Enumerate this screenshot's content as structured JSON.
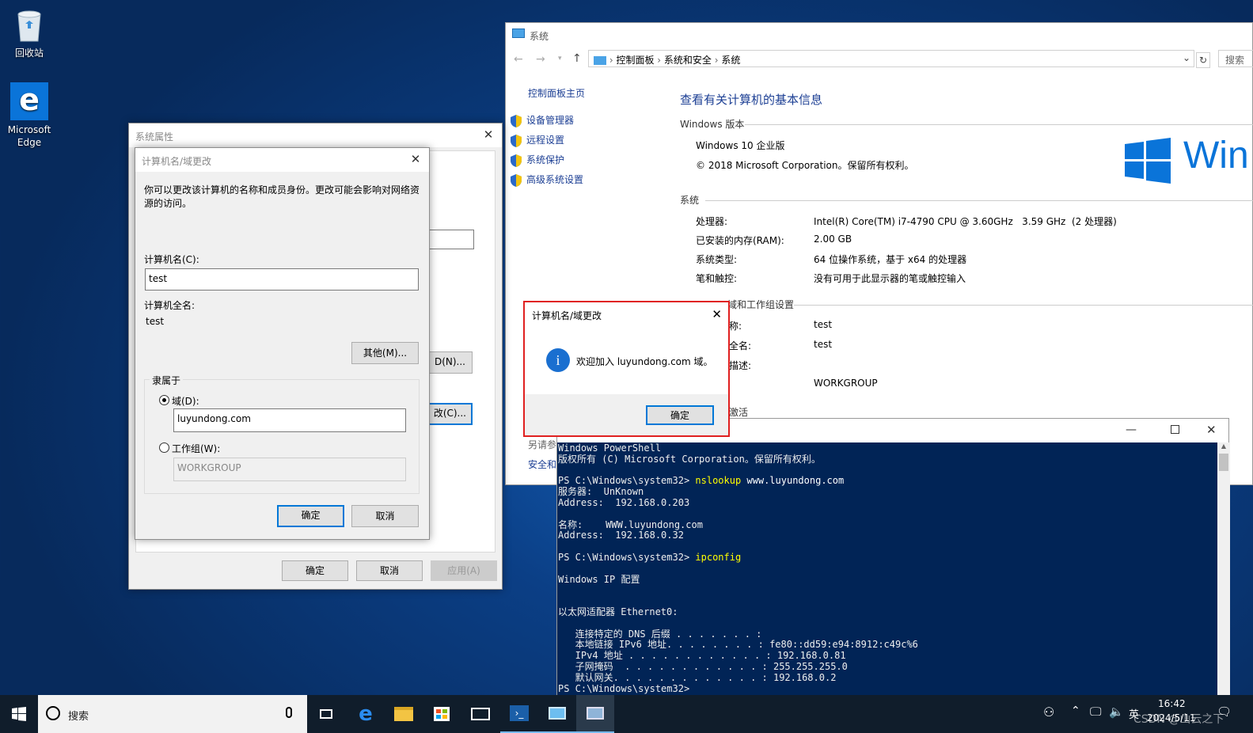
{
  "desktop": {
    "recycle_bin": "回收站",
    "edge": "Microsoft Edge"
  },
  "sysprops": {
    "title": "系统属性",
    "buttons": {
      "ok": "确定",
      "cancel": "取消",
      "apply": "应用(A)"
    },
    "partial_d": "D(N)...",
    "partial_c": "改(C)..."
  },
  "namechange": {
    "title": "计算机名/域更改",
    "desc": "你可以更改该计算机的名称和成员身份。更改可能会影响对网络资源的访问。",
    "computer_name_label": "计算机名(C):",
    "computer_name_value": "test",
    "full_name_label": "计算机全名:",
    "full_name_value": "test",
    "other_button": "其他(M)...",
    "member_of": "隶属于",
    "domain_label": "域(D):",
    "domain_value": "luyundong.com",
    "workgroup_label": "工作组(W):",
    "workgroup_value": "WORKGROUP",
    "ok": "确定",
    "cancel": "取消"
  },
  "system": {
    "title": "系统",
    "breadcrumb": [
      "控制面板",
      "系统和安全",
      "系统"
    ],
    "search": "搜索",
    "sidebar_home": "控制面板主页",
    "sidebar_links": [
      "设备管理器",
      "远程设置",
      "系统保护",
      "高级系统设置"
    ],
    "see_also": "另请参",
    "security": "安全和",
    "heading": "查看有关计算机的基本信息",
    "edition_section": "Windows 版本",
    "edition": "Windows 10 企业版",
    "copyright": "© 2018 Microsoft Corporation。保留所有权利。",
    "logo_text": "Win",
    "system_section": "系统",
    "rows": [
      {
        "k": "处理器:",
        "v": "Intel(R) Core(TM) i7-4790 CPU @ 3.60GHz   3.59 GHz  (2 处理器)"
      },
      {
        "k": "已安装的内存(RAM):",
        "v": "2.00 GB"
      },
      {
        "k": "系统类型:",
        "v": "64 位操作系统，基于 x64 的处理器"
      },
      {
        "k": "笔和触控:",
        "v": "没有可用于此显示器的笔或触控输入"
      }
    ],
    "name_section": "计算机名、域和工作组设置",
    "name_section_visible": "域和工作组设置",
    "name_rows": [
      {
        "k": "称:",
        "v": "test"
      },
      {
        "k": "全名:",
        "v": "test"
      },
      {
        "k": "描述:",
        "v": ""
      },
      {
        "k": "",
        "v": "WORKGROUP"
      }
    ],
    "activation_partial": "激活"
  },
  "msgbox": {
    "title": "计算机名/域更改",
    "message": "欢迎加入 luyundong.com 域。",
    "ok": "确定",
    "highlight_color": "#e02020"
  },
  "powershell": {
    "lines": [
      {
        "t": "Windows PowerShell"
      },
      {
        "t": "版权所有 (C) Microsoft Corporation。保留所有权利。"
      },
      {
        "t": ""
      },
      {
        "p": "PS C:\\Windows\\system32> ",
        "c": "nslookup",
        "a": " www.luyundong.com"
      },
      {
        "t": "服务器:  UnKnown"
      },
      {
        "t": "Address:  192.168.0.203"
      },
      {
        "t": ""
      },
      {
        "t": "名称:    WWW.luyundong.com"
      },
      {
        "t": "Address:  192.168.0.32"
      },
      {
        "t": ""
      },
      {
        "p": "PS C:\\Windows\\system32> ",
        "c": "ipconfig",
        "a": ""
      },
      {
        "t": ""
      },
      {
        "t": "Windows IP 配置"
      },
      {
        "t": ""
      },
      {
        "t": ""
      },
      {
        "t": "以太网适配器 Ethernet0:"
      },
      {
        "t": ""
      },
      {
        "t": "   连接特定的 DNS 后缀 . . . . . . . :"
      },
      {
        "t": "   本地链接 IPv6 地址. . . . . . . . : fe80::dd59:e94:8912:c49c%6"
      },
      {
        "t": "   IPv4 地址 . . . . . . . . . . . . : 192.168.0.81"
      },
      {
        "t": "   子网掩码  . . . . . . . . . . . . : 255.255.255.0"
      },
      {
        "t": "   默认网关. . . . . . . . . . . . . : 192.168.0.2"
      },
      {
        "t": "PS C:\\Windows\\system32>"
      }
    ]
  },
  "taskbar": {
    "search": "搜索",
    "ime": "英",
    "time": "16:42",
    "date": "2024/5/11",
    "watermark": "CSDN @山云之下"
  }
}
